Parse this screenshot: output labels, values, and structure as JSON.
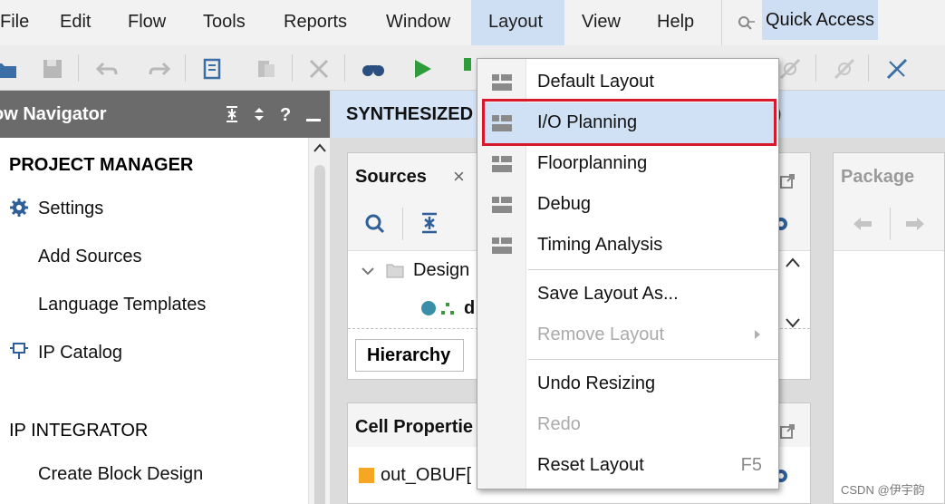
{
  "menubar": {
    "items": [
      {
        "label": "File",
        "name": "menu-file"
      },
      {
        "label": "Edit",
        "name": "menu-edit"
      },
      {
        "label": "Flow",
        "name": "menu-flow"
      },
      {
        "label": "Tools",
        "name": "menu-tools"
      },
      {
        "label": "Reports",
        "name": "menu-reports"
      },
      {
        "label": "Window",
        "name": "menu-window"
      },
      {
        "label": "Layout",
        "name": "menu-layout"
      },
      {
        "label": "View",
        "name": "menu-view"
      },
      {
        "label": "Help",
        "name": "menu-help"
      }
    ],
    "active": "Layout",
    "quick_access_label": "Quick Access"
  },
  "navigator": {
    "title": "ow Navigator",
    "project_manager": "PROJECT MANAGER",
    "settings": "Settings",
    "add_sources": "Add Sources",
    "language_templates": "Language Templates",
    "ip_catalog": "IP Catalog",
    "ip_integrator": "IP INTEGRATOR",
    "create_block_design": "Create Block Design"
  },
  "main": {
    "synthesized_title": "SYNTHESIZED",
    "synthesized_suffix": ")",
    "sources": {
      "title": "Sources",
      "close": "×",
      "design_row": "Design",
      "child_row": "d",
      "hierarchy_tab": "Hierarchy"
    },
    "cell_properties": {
      "title": "Cell Propertie",
      "item": "out_OBUF["
    },
    "package": {
      "title": "Package"
    }
  },
  "layout_menu": {
    "items": [
      {
        "label": "Default Layout",
        "icon": "layout-icon",
        "enabled": true
      },
      {
        "label": "I/O Planning",
        "icon": "layout-icon",
        "enabled": true,
        "highlighted": true
      },
      {
        "label": "Floorplanning",
        "icon": "layout-icon",
        "enabled": true
      },
      {
        "label": "Debug",
        "icon": "layout-icon",
        "enabled": true
      },
      {
        "label": "Timing Analysis",
        "icon": "layout-icon",
        "enabled": true
      },
      {
        "label": "Save Layout As...",
        "enabled": true
      },
      {
        "label": "Remove Layout",
        "enabled": false,
        "submenu": true
      },
      {
        "label": "Undo Resizing",
        "enabled": true
      },
      {
        "label": "Redo",
        "enabled": false
      },
      {
        "label": "Reset Layout",
        "enabled": true,
        "shortcut": "F5"
      }
    ]
  },
  "watermark": "CSDN @伊宇韵",
  "colors": {
    "menubar_bg": "#f2f2f2",
    "active_menu_bg": "#cfdff3",
    "navigator_header_bg": "#6b6b6b",
    "synthesized_bar_bg": "#d5e3f7",
    "highlight_border": "#d9182b",
    "selected_item_bg": "#d0e0f5"
  }
}
